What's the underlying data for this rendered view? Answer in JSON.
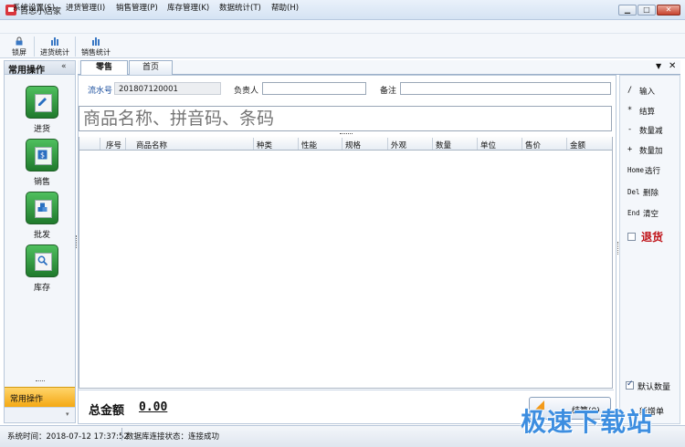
{
  "window": {
    "title": "百思小店家"
  },
  "menu": [
    "系统设置(S)",
    "进货管理(I)",
    "销售管理(P)",
    "库存管理(K)",
    "数据统计(T)",
    "帮助(H)"
  ],
  "toolbar": {
    "lock": "锁屏",
    "purchase_stats": "进货统计",
    "sales_stats": "销售统计"
  },
  "left_panel": {
    "title": "常用操作",
    "collapse": "«",
    "items": [
      "进货",
      "销售",
      "批发",
      "库存"
    ],
    "common": "常用操作"
  },
  "tabs": {
    "retail": "零售",
    "home": "首页"
  },
  "form": {
    "serial_label": "流水号",
    "serial_value": "201807120001",
    "person_label": "负责人",
    "person_value": "",
    "note_label": "备注",
    "note_value": "",
    "search_placeholder": "商品名称、拼音码、条码"
  },
  "table": {
    "headers": [
      "序号",
      "商品名称",
      "种类",
      "性能",
      "规格",
      "外观",
      "数量",
      "单位",
      "售价",
      "金额"
    ]
  },
  "total": {
    "label": "总金额",
    "value": "0.00"
  },
  "settle_button": "结算(0)",
  "shortcuts": [
    {
      "key": "/",
      "desc": "输入"
    },
    {
      "key": "*",
      "desc": "结算"
    },
    {
      "key": "-",
      "desc": "数量减"
    },
    {
      "key": "+",
      "desc": "数量加"
    },
    {
      "key": "Home",
      "desc": "选行"
    },
    {
      "key": "Del",
      "desc": "删除"
    },
    {
      "key": "End",
      "desc": "清空"
    }
  ],
  "return_label": "退货",
  "default_qty": "默认数量",
  "new_order": "新增单",
  "status": {
    "time": "系统时间：2018-07-12 17:37:52",
    "db": "数据库连接状态：连接成功"
  },
  "watermark": "极速下载站",
  "colors": {
    "accent_green": "#1f7a2c",
    "return_red": "#c0141a",
    "settle_orange": "#f4a914"
  }
}
